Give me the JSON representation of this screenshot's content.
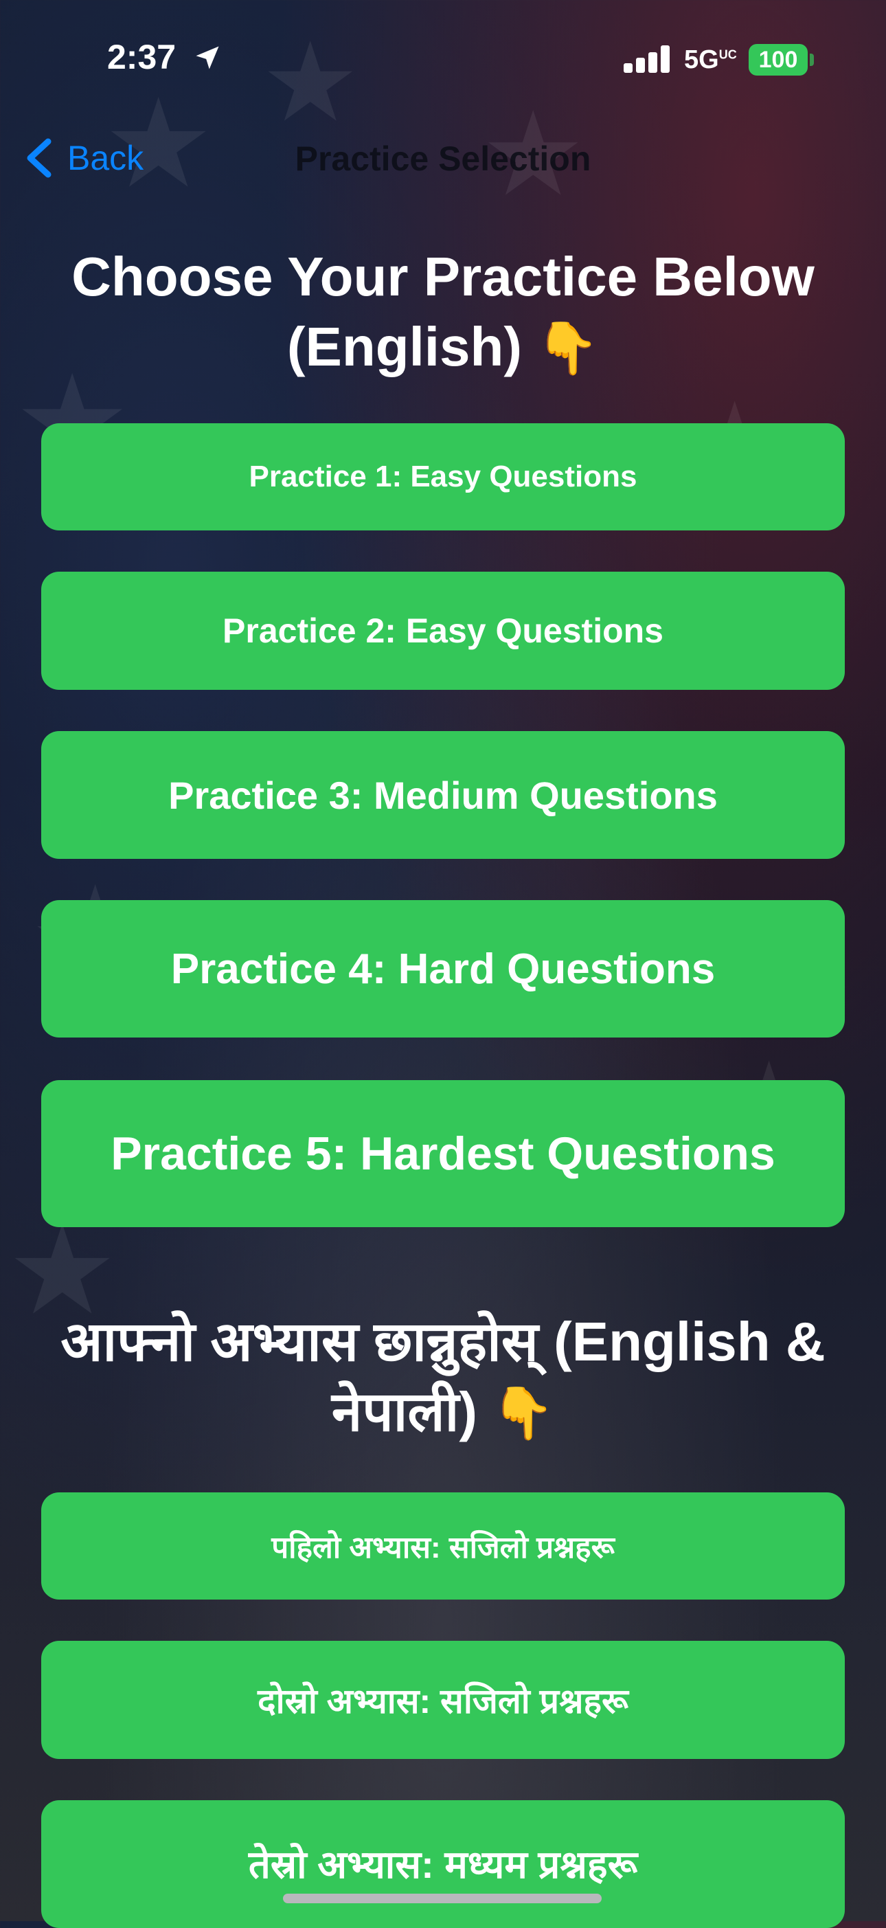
{
  "status_bar": {
    "time": "2:37",
    "network": "5G",
    "network_suffix": "UC",
    "battery": "100",
    "location_icon": "location-arrow-icon",
    "signal_icon": "cellular-signal-icon"
  },
  "nav": {
    "back_label": "Back",
    "title": "Practice Selection"
  },
  "sections": [
    {
      "heading": "Choose Your Practice Below (English)",
      "heading_icon": "👇",
      "buttons": [
        "Practice 1: Easy Questions",
        "Practice 2: Easy Questions",
        "Practice 3: Medium Questions",
        "Practice 4: Hard Questions",
        "Practice 5: Hardest Questions"
      ]
    },
    {
      "heading": "आफ्नो अभ्यास छान्नुहोस् (English & नेपाली)",
      "heading_icon": "👇",
      "buttons": [
        "पहिलो अभ्यास: सजिलो प्रश्नहरू",
        "दोस्रो अभ्यास: सजिलो प्रश्नहरू",
        "तेस्रो अभ्यास: मध्यम प्रश्नहरू"
      ]
    }
  ],
  "colors": {
    "button_green": "#34c759",
    "accent_blue": "#0a84ff"
  }
}
